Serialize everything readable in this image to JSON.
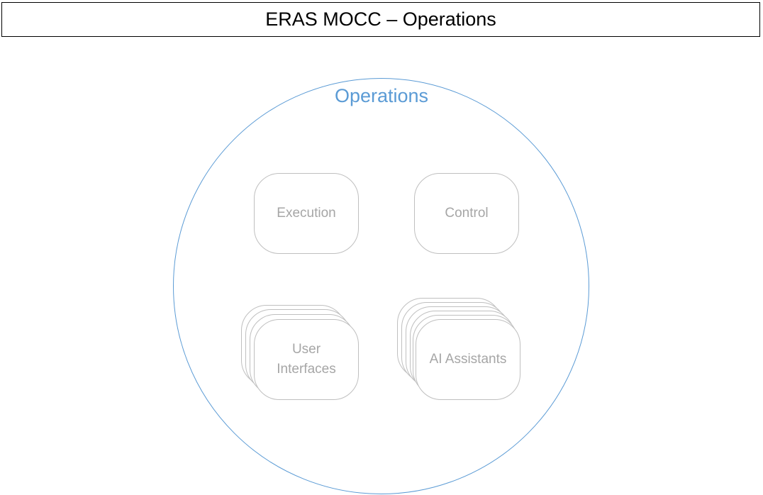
{
  "title": "ERAS MOCC – Operations",
  "group": {
    "label": "Operations"
  },
  "nodes": {
    "execution": "Execution",
    "control": "Control",
    "user_interfaces": "User\nInterfaces",
    "ai_assistants": "AI Assistants"
  },
  "colors": {
    "title_border": "#000000",
    "circle_stroke": "#5b9bd5",
    "circle_label": "#5b9bd5",
    "node_border": "#bfbfbf",
    "node_text": "#a6a6a6"
  }
}
